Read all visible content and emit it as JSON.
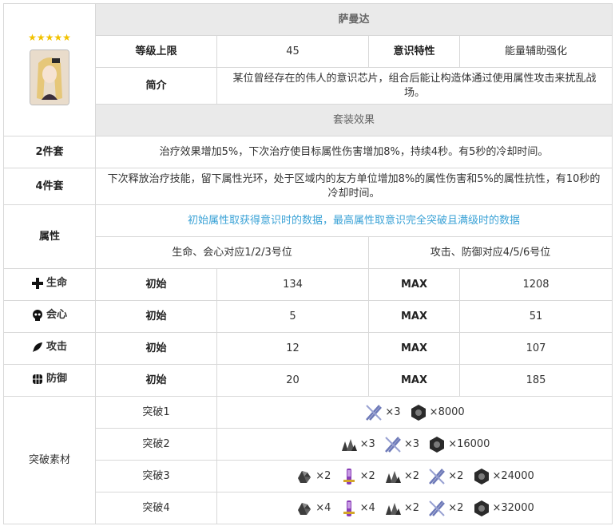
{
  "character": {
    "stars": "★★★★★",
    "name": "萨曼达",
    "level_cap_label": "等级上限",
    "level_cap": "45",
    "trait_label": "意识特性",
    "trait": "能量辅助强化",
    "intro_label": "简介",
    "intro": "某位曾经存在的伟人的意识芯片，组合后能让构造体通过使用属性攻击来扰乱战场。"
  },
  "set_effect": {
    "header": "套装效果",
    "two_label": "2件套",
    "two_text": "治疗效果增加5%，下次治疗使目标属性伤害增加8%，持续4秒。有5秒的冷却时间。",
    "four_label": "4件套",
    "four_text": "下次释放治疗技能，留下属性光环，处于区域内的友方单位增加8%的属性伤害和5%的属性抗性，有10秒的冷却时间。"
  },
  "attributes": {
    "label": "属性",
    "note": "初始属性取获得意识时的数据，最高属性取意识完全突破且满级时的数据",
    "slots_left": "生命、会心对应1/2/3号位",
    "slots_right": "攻击、防御对应4/5/6号位",
    "init_label": "初始",
    "max_label": "MAX",
    "rows": [
      {
        "name": "生命",
        "icon": "plus-icon",
        "init": "134",
        "max": "1208"
      },
      {
        "name": "会心",
        "icon": "skull-icon",
        "init": "5",
        "max": "51"
      },
      {
        "name": "攻击",
        "icon": "feather-icon",
        "init": "12",
        "max": "107"
      },
      {
        "name": "防御",
        "icon": "armor-icon",
        "init": "20",
        "max": "185"
      }
    ]
  },
  "breakthrough": {
    "label": "突破素材",
    "rows": [
      {
        "stage": "突破1",
        "items": [
          {
            "icon": "tweezers-icon",
            "qty": "×3"
          },
          {
            "icon": "hex-nut-icon",
            "qty": "×8000"
          }
        ]
      },
      {
        "stage": "突破2",
        "items": [
          {
            "icon": "rubble-icon",
            "qty": "×3"
          },
          {
            "icon": "tweezers-icon",
            "qty": "×3"
          },
          {
            "icon": "hex-nut-icon",
            "qty": "×16000"
          }
        ]
      },
      {
        "stage": "突破3",
        "items": [
          {
            "icon": "ore-icon",
            "qty": "×2"
          },
          {
            "icon": "vial-icon",
            "qty": "×2"
          },
          {
            "icon": "rubble-icon",
            "qty": "×2"
          },
          {
            "icon": "tweezers-icon",
            "qty": "×2"
          },
          {
            "icon": "hex-nut-icon",
            "qty": "×24000"
          }
        ]
      },
      {
        "stage": "突破4",
        "items": [
          {
            "icon": "ore-icon",
            "qty": "×4"
          },
          {
            "icon": "vial-icon",
            "qty": "×4"
          },
          {
            "icon": "rubble-icon",
            "qty": "×2"
          },
          {
            "icon": "tweezers-icon",
            "qty": "×2"
          },
          {
            "icon": "hex-nut-icon",
            "qty": "×32000"
          }
        ]
      }
    ]
  }
}
